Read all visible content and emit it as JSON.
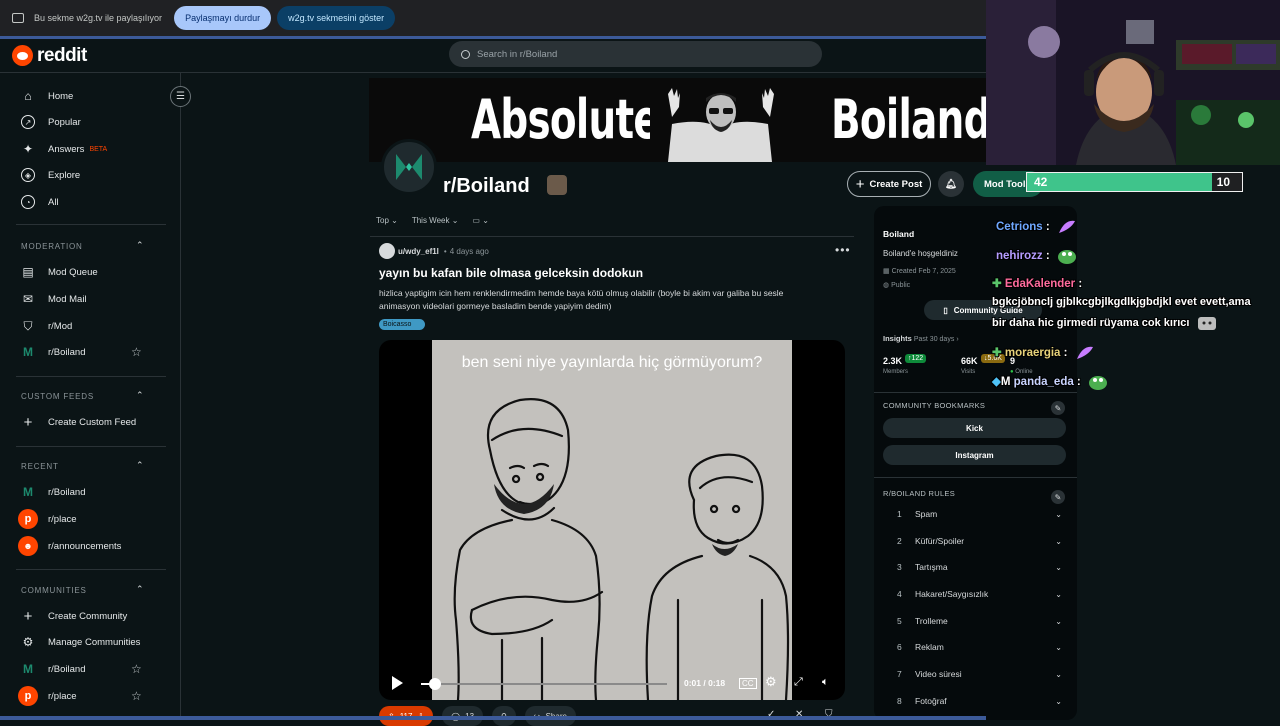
{
  "sharebar": {
    "message": "Bu sekme w2g.tv ile paylaşılıyor",
    "stop_label": "Paylaşmayı durdur",
    "show_label": "w2g.tv sekmesini göster"
  },
  "header": {
    "logo_text": "reddit",
    "search_placeholder": "Search in r/Boiland"
  },
  "sidebar": {
    "main": [
      {
        "label": "Home",
        "icon": "home-icon"
      },
      {
        "label": "Popular",
        "icon": "popular-icon"
      },
      {
        "label": "Answers",
        "icon": "answers-icon",
        "badge": "BETA"
      },
      {
        "label": "Explore",
        "icon": "explore-icon"
      },
      {
        "label": "All",
        "icon": "all-icon"
      }
    ],
    "moderation": {
      "title": "MODERATION",
      "items": [
        "Mod Queue",
        "Mod Mail",
        "r/Mod",
        "r/Boiland"
      ]
    },
    "custom_feeds": {
      "title": "CUSTOM FEEDS",
      "items": [
        "Create Custom Feed"
      ]
    },
    "recent": {
      "title": "RECENT",
      "items": [
        "r/Boiland",
        "r/place",
        "r/announcements"
      ]
    },
    "communities": {
      "title": "COMMUNITIES",
      "items": [
        "Create Community",
        "Manage Communities",
        "r/Boiland",
        "r/place"
      ]
    }
  },
  "banner": {
    "left_text": "Absolute",
    "right_text": "Boiland"
  },
  "community": {
    "name": "r/Boiland",
    "create_post": "Create Post",
    "mod_tools": "Mod Tools"
  },
  "feed": {
    "sort": "Top",
    "range": "This Week"
  },
  "post": {
    "user": "u/wdy_ef1l",
    "time": "4 days ago",
    "title": "yayın bu kafan bile olmasa gelceksin dodokun",
    "body": "hizlica yaptigim icin hem renklendirmedim hemde baya kötü olmuş olabilir (boyle bi akim var galiba bu sesle animasyon videolari gormeye basladim bende yapiyim dedim)",
    "flair": "Boicasso",
    "video": {
      "caption": "ben seni niye yayınlarda hiç görmüyorum?",
      "time": "0:01 / 0:18",
      "progress": 0.0556
    },
    "votes": "117",
    "comments": "13",
    "share": "Share"
  },
  "about": {
    "title": "Boiland",
    "description": "Boiland'e hoşgeldiniz",
    "created": "Created Feb 7, 2025",
    "visibility": "Public",
    "guide_button": "Community Guide",
    "insights_label": "Insights",
    "insights_range": "Past 30 days",
    "members_value": "2.3K",
    "members_delta": "↑122",
    "members_label": "Members",
    "visits_value": "66K",
    "visits_delta": "↓5.6K",
    "visits_label": "Visits",
    "online_value": "9",
    "online_label": "Online"
  },
  "bookmarks": {
    "title": "COMMUNITY BOOKMARKS",
    "items": [
      "Kick",
      "Instagram"
    ]
  },
  "rules": {
    "title": "R/BOILAND RULES",
    "items": [
      {
        "n": "1",
        "label": "Spam"
      },
      {
        "n": "2",
        "label": "Küfür/Spoiler"
      },
      {
        "n": "3",
        "label": "Tartışma"
      },
      {
        "n": "4",
        "label": "Hakaret/Saygısızlık"
      },
      {
        "n": "5",
        "label": "Trolleme"
      },
      {
        "n": "6",
        "label": "Reklam"
      },
      {
        "n": "7",
        "label": "Video süresi"
      },
      {
        "n": "8",
        "label": "Fotoğraf"
      }
    ]
  },
  "stream": {
    "goal_current": "42",
    "goal_target": "10",
    "goal_fill": 0.86,
    "chat": [
      {
        "name": "Cetrions",
        "color": "#6fa8ff",
        "message": ""
      },
      {
        "name": "nehirozz",
        "color": "#b59cff",
        "message": ""
      },
      {
        "name": "EdaKalender",
        "color": "#ff6b9d",
        "message": ""
      },
      {
        "name": "",
        "color": "#ffffff",
        "message": "bgkcjöbnclj gjblkcgbjlkgdlkjgbdjkl evet evett,ama"
      },
      {
        "name": "",
        "color": "#ffffff",
        "message": "bir daha hic girmedi rüyama cok kırıcı"
      },
      {
        "name": "moraergia",
        "color": "#e7d27a",
        "message": ""
      },
      {
        "name": "panda_eda",
        "color": "#c9d4ff",
        "message": ""
      }
    ]
  },
  "colors": {
    "accent": "#ff4500",
    "mod": "#115e46",
    "bg": "#0b1416"
  }
}
